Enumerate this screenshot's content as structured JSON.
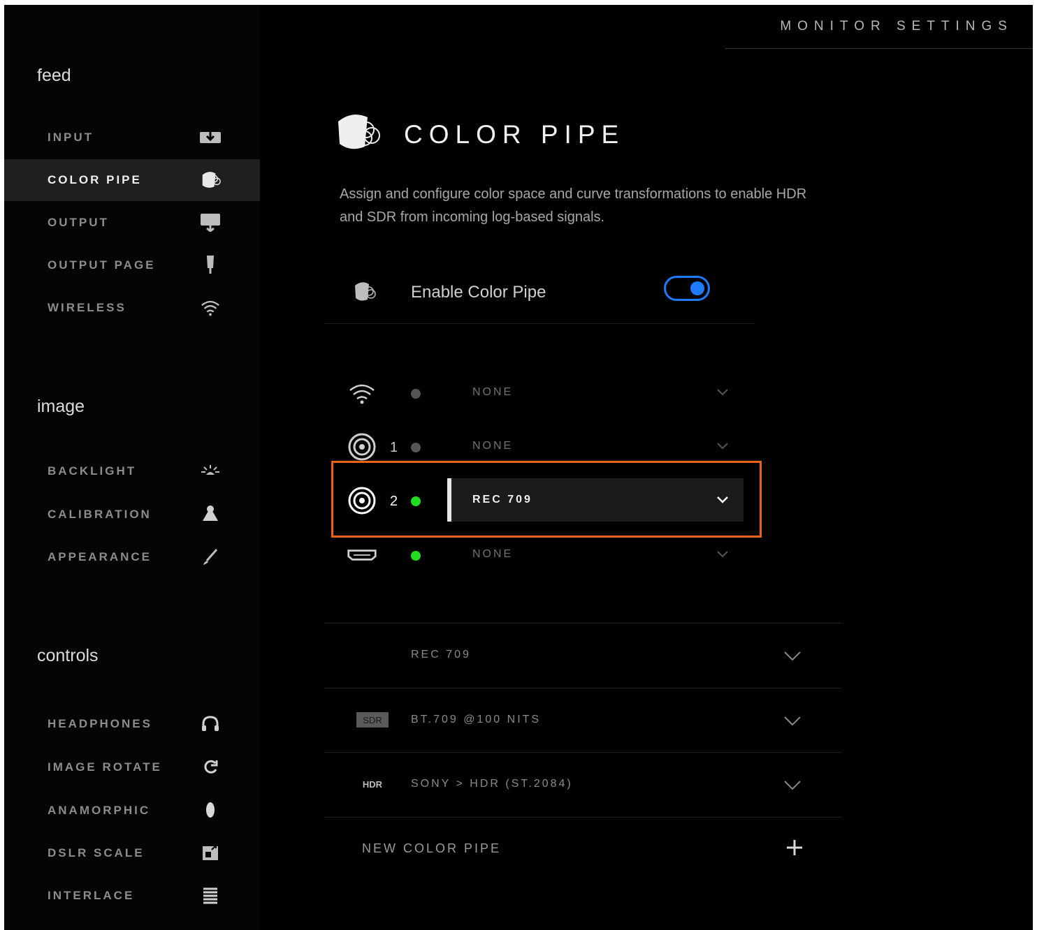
{
  "header": {
    "title": "MONITOR SETTINGS"
  },
  "sidebar": {
    "sections": [
      {
        "heading": "feed",
        "items": [
          {
            "label": "INPUT",
            "icon": "input-icon"
          },
          {
            "label": "COLOR PIPE",
            "icon": "color-pipe-icon",
            "active": true
          },
          {
            "label": "OUTPUT",
            "icon": "output-icon"
          },
          {
            "label": "OUTPUT PAGE",
            "icon": "output-page-icon"
          },
          {
            "label": "WIRELESS",
            "icon": "wireless-icon"
          }
        ]
      },
      {
        "heading": "image",
        "items": [
          {
            "label": "BACKLIGHT",
            "icon": "backlight-icon"
          },
          {
            "label": "CALIBRATION",
            "icon": "calibration-icon"
          },
          {
            "label": "APPEARANCE",
            "icon": "appearance-icon"
          }
        ]
      },
      {
        "heading": "controls",
        "items": [
          {
            "label": "HEADPHONES",
            "icon": "headphones-icon"
          },
          {
            "label": "IMAGE ROTATE",
            "icon": "rotate-icon"
          },
          {
            "label": "ANAMORPHIC",
            "icon": "anamorphic-icon"
          },
          {
            "label": "DSLR SCALE",
            "icon": "dslr-scale-icon"
          },
          {
            "label": "INTERLACE",
            "icon": "interlace-icon"
          }
        ]
      }
    ]
  },
  "main": {
    "title": "COLOR PIPE",
    "description": "Assign and configure color space and curve transformations to enable HDR and SDR from incoming log-based signals.",
    "enable": {
      "label": "Enable Color Pipe",
      "on": true
    },
    "inputs": [
      {
        "icon": "wifi-icon",
        "number": "",
        "status": "inactive",
        "value": "NONE"
      },
      {
        "icon": "sdi-icon",
        "number": "1",
        "status": "inactive",
        "value": "NONE"
      },
      {
        "icon": "sdi-icon",
        "number": "2",
        "status": "active",
        "value": "REC 709"
      },
      {
        "icon": "hdmi-icon",
        "number": "",
        "status": "active",
        "value": "NONE"
      }
    ],
    "pipes": [
      {
        "badge": "",
        "label": "REC 709"
      },
      {
        "badge": "SDR",
        "label": "BT.709 @100 NITS"
      },
      {
        "badge": "HDR",
        "label": "SONY  >  HDR (ST.2084)"
      }
    ],
    "new_pipe_label": "NEW COLOR PIPE"
  },
  "colors": {
    "accent": "#1e7bff",
    "active_dot": "#22dd22",
    "inactive_dot": "#555555",
    "highlight": "#e66414",
    "background": "#000000"
  }
}
